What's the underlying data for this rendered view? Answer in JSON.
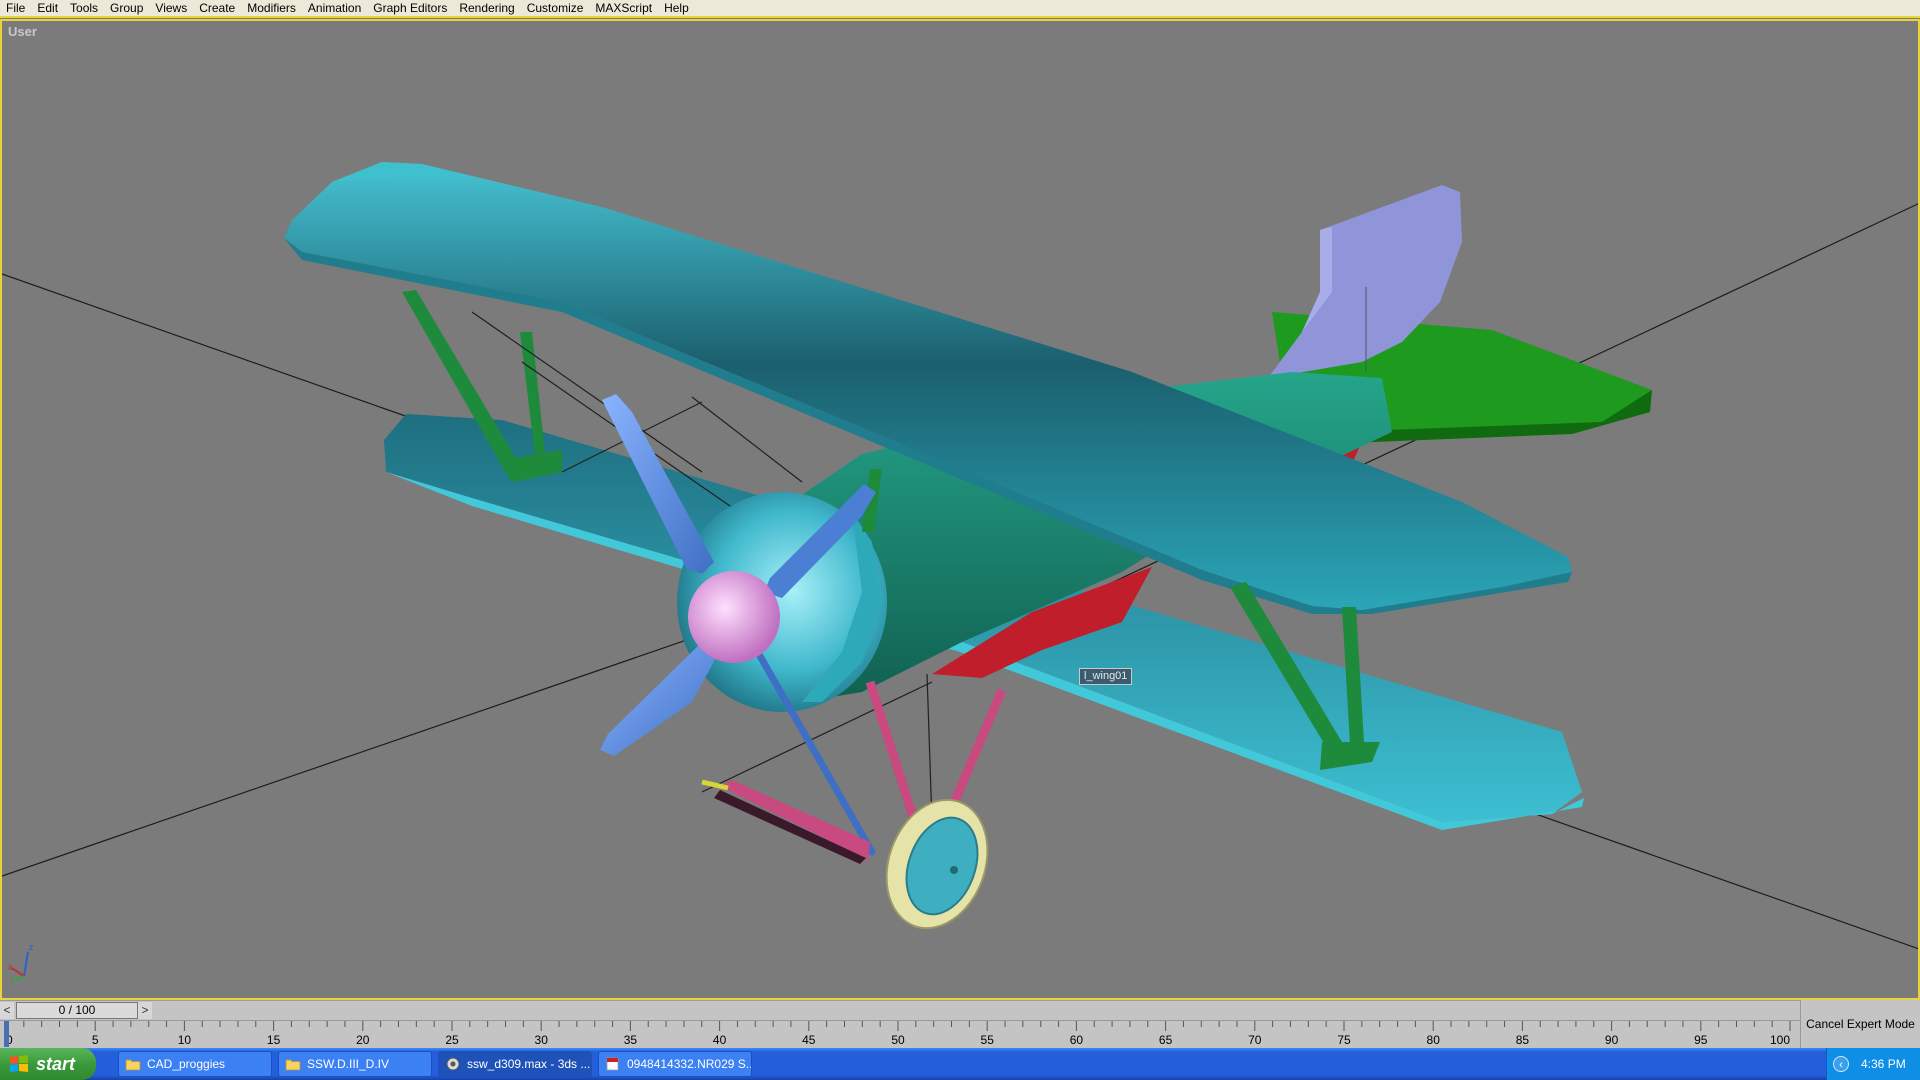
{
  "menu": [
    "File",
    "Edit",
    "Tools",
    "Group",
    "Views",
    "Create",
    "Modifiers",
    "Animation",
    "Graph Editors",
    "Rendering",
    "Customize",
    "MAXScript",
    "Help"
  ],
  "viewport": {
    "label": "User",
    "tooltip": "l_wing01",
    "axis_labels": {
      "z": "z",
      "x": "x",
      "y": "y"
    }
  },
  "timeslider": {
    "frame": "0 / 100",
    "left_arrow": "<",
    "right_arrow": ">"
  },
  "trackbar": {
    "tick_labels": [
      "0",
      "5",
      "10",
      "15",
      "20",
      "25",
      "30",
      "35",
      "40",
      "45",
      "50",
      "55",
      "60",
      "65",
      "70",
      "75",
      "80",
      "85",
      "90",
      "95",
      "100"
    ]
  },
  "cancel_expert_mode": "Cancel Expert Mode",
  "taskbar": {
    "start_label": "start",
    "buttons": [
      {
        "label": "CAD_proggies",
        "icon": "folder-icon"
      },
      {
        "label": "SSW.D.III_D.IV",
        "icon": "folder-icon"
      },
      {
        "label": "ssw_d309.max - 3ds ...",
        "icon": "3dsmax-icon"
      },
      {
        "label": "0948414332.NR029 S...",
        "icon": "pdf-icon"
      }
    ],
    "tray_arrow": "‹",
    "clock": "4:36 PM"
  },
  "colors": {
    "menu_bg": "#ece9d8",
    "viewport_bg": "#7b7b7b",
    "active_border": "#e6d43a",
    "wing": "#2aa6b8",
    "fuselage": "#1f8f7a",
    "strut": "#1e8a3c",
    "propeller": "#5c8fe0",
    "spinner": "#e6a0e0",
    "rudder": "#8f95d8",
    "stabilizer": "#1e9a1e",
    "belly": "#c01e2a",
    "landing_gear": "#c84a80",
    "wheel": "#e6e3a8",
    "taskbar": "#245edb",
    "start_button": "#3a9a3a"
  }
}
